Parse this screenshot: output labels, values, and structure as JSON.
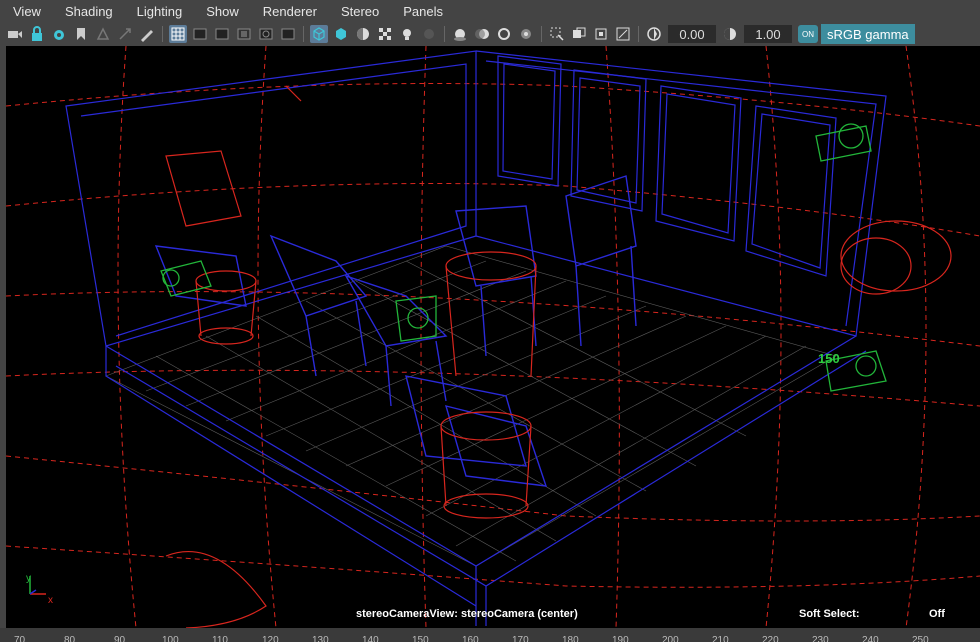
{
  "menu": [
    "View",
    "Shading",
    "Lighting",
    "Show",
    "Renderer",
    "Stereo",
    "Panels"
  ],
  "toolbar": {
    "icons": [
      "camera-select-icon",
      "lock-camera-icon",
      "camera-attributes-icon",
      "bookmark-icon",
      "image-plane-icon",
      "2d-pan-zoom-icon",
      "grease-pencil-icon",
      "grid-icon",
      "film-gate-icon",
      "resolution-gate-icon",
      "gate-mask-icon",
      "field-chart-icon",
      "safe-action-icon",
      "wireframe-icon",
      "smooth-shade-icon",
      "default-material-icon",
      "textured-icon",
      "use-all-lights-icon",
      "shadows-icon",
      "screen-space-ao-icon",
      "motion-blur-icon",
      "multisample-aa-icon",
      "depth-of-field-icon",
      "isolate-select-icon",
      "xray-icon",
      "xray-active-icon",
      "xray-joints-icon",
      "exposure-icon",
      "gamma-icon"
    ],
    "exposure_value": "0.00",
    "gamma_value": "1.00",
    "color_mgmt_toggle": "ON",
    "view_transform": "sRGB gamma"
  },
  "viewport": {
    "camera_label": "stereoCameraView: stereoCamera (center)",
    "soft_select_label": "Soft Select:",
    "soft_select_value": "Off",
    "camera_number": "150",
    "axis_y": "y",
    "axis_x": "x"
  },
  "ruler": [
    "70",
    "80",
    "90",
    "100",
    "110",
    "120",
    "130",
    "140",
    "150",
    "160",
    "170",
    "180",
    "190",
    "200",
    "210",
    "220",
    "230",
    "240",
    "250"
  ],
  "colors": {
    "wire_blue": "#2a2ad8",
    "wire_red": "#d8261e",
    "wire_green": "#22b53a",
    "accent": "#3d8d9e",
    "ui_bg": "#444444"
  }
}
